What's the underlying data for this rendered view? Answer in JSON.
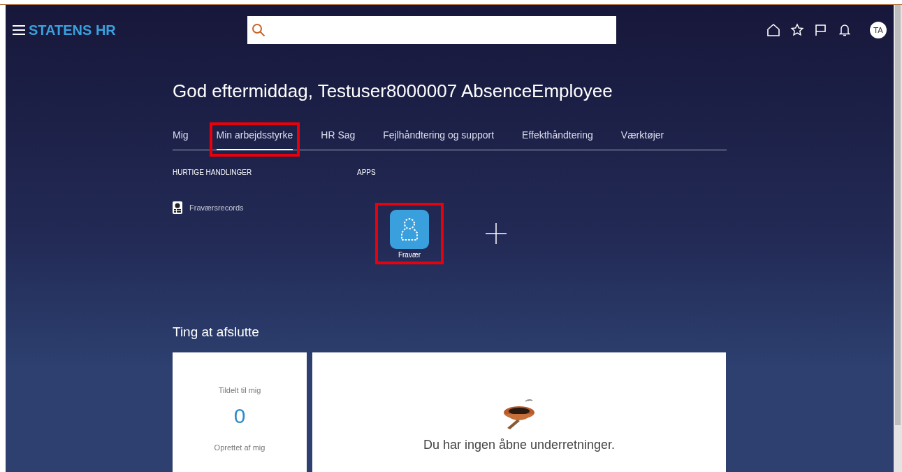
{
  "header": {
    "brand": "STATENS HR",
    "avatar": "TA"
  },
  "greeting": "God eftermiddag, Testuser8000007 AbsenceEmployee",
  "tabs": [
    {
      "label": "Mig",
      "selected": false,
      "highlighted": false
    },
    {
      "label": "Min arbejdsstyrke",
      "selected": true,
      "highlighted": true
    },
    {
      "label": "HR Sag",
      "selected": false,
      "highlighted": false
    },
    {
      "label": "Fejlhåndtering og support",
      "selected": false,
      "highlighted": false
    },
    {
      "label": "Effekthåndtering",
      "selected": false,
      "highlighted": false
    },
    {
      "label": "Værktøjer",
      "selected": false,
      "highlighted": false
    }
  ],
  "quick_actions": {
    "heading": "HURTIGE HANDLINGER",
    "items": [
      {
        "label": "Fraværsrecords"
      }
    ]
  },
  "apps": {
    "heading": "APPS",
    "items": [
      {
        "label": "Fravær",
        "highlighted": true
      }
    ]
  },
  "things_to_finish": {
    "heading": "Ting at afslutte",
    "assigned_label": "Tildelt til mig",
    "assigned_count": "0",
    "created_label": "Oprettet af mig",
    "empty_message": "Du har ingen åbne underretninger."
  }
}
